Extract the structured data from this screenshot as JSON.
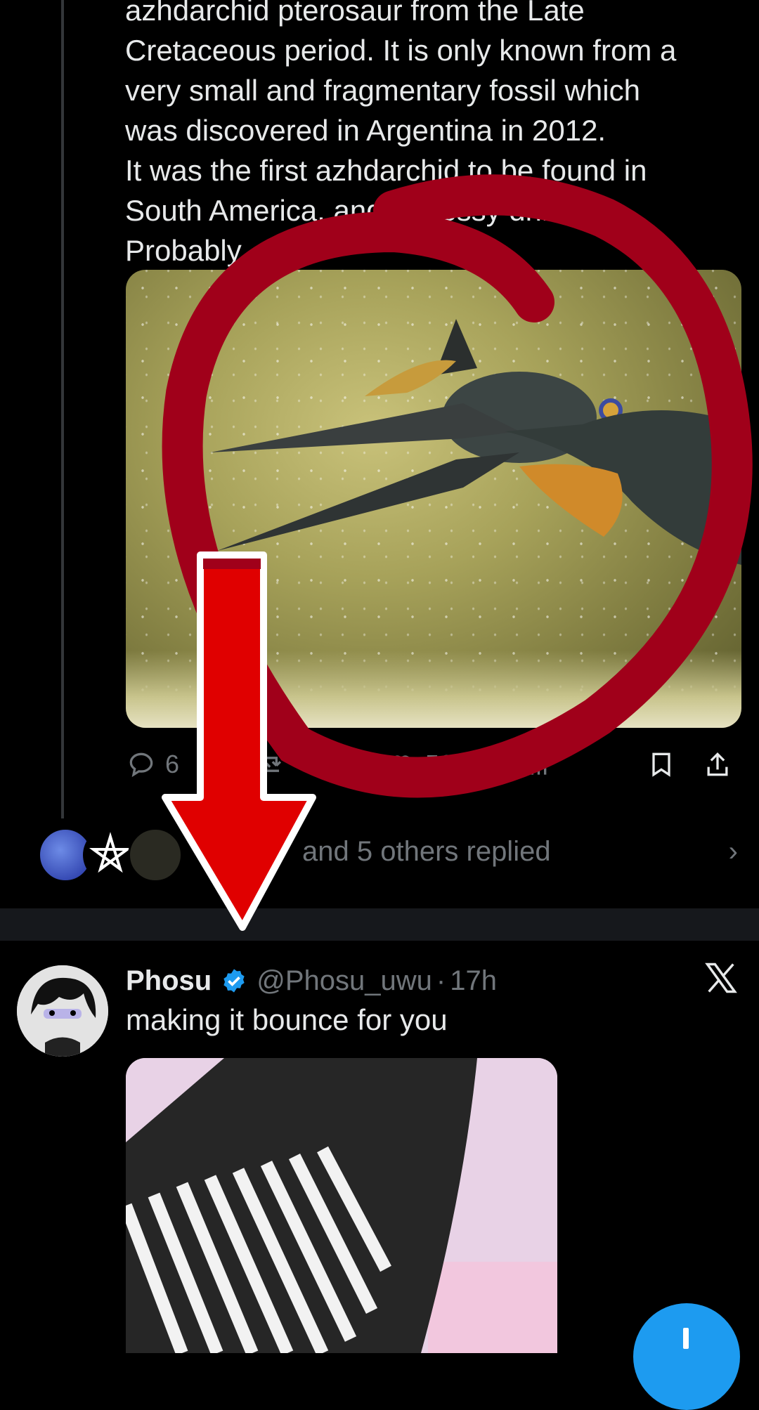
{
  "tweet1": {
    "text": "azhdarchid pterosaur from the Late\nCretaceous period. It is only known from a\nvery small and fragmentary fossil which\nwas discovered in Argentina in 2012.\nIt was the first azhdarchid to be found in\nSouth America, and a messy drinker.\nProbably.",
    "media_alt": "pterosaur illustration",
    "replies": "6",
    "likes": "563"
  },
  "replied_row": {
    "text": "and 5 others replied",
    "chevron": "›"
  },
  "tweet2": {
    "name": "Phosu",
    "handle": "@Phosu_uwu",
    "separator": "·",
    "time": "17h",
    "text": "making it bounce for you"
  },
  "icons": {
    "reply": "reply-icon",
    "retweet": "retweet-icon",
    "like": "heart-icon",
    "views": "views-icon",
    "bookmark": "bookmark-icon",
    "share": "share-icon",
    "verified": "verified-badge-icon",
    "x_logo": "x-logo-icon",
    "compose": "compose-plus-icon"
  },
  "colors": {
    "accent": "#1d9bf0",
    "muted": "#71767b",
    "annotation_red": "#e00000",
    "annotation_dark_red": "#a0001a"
  }
}
